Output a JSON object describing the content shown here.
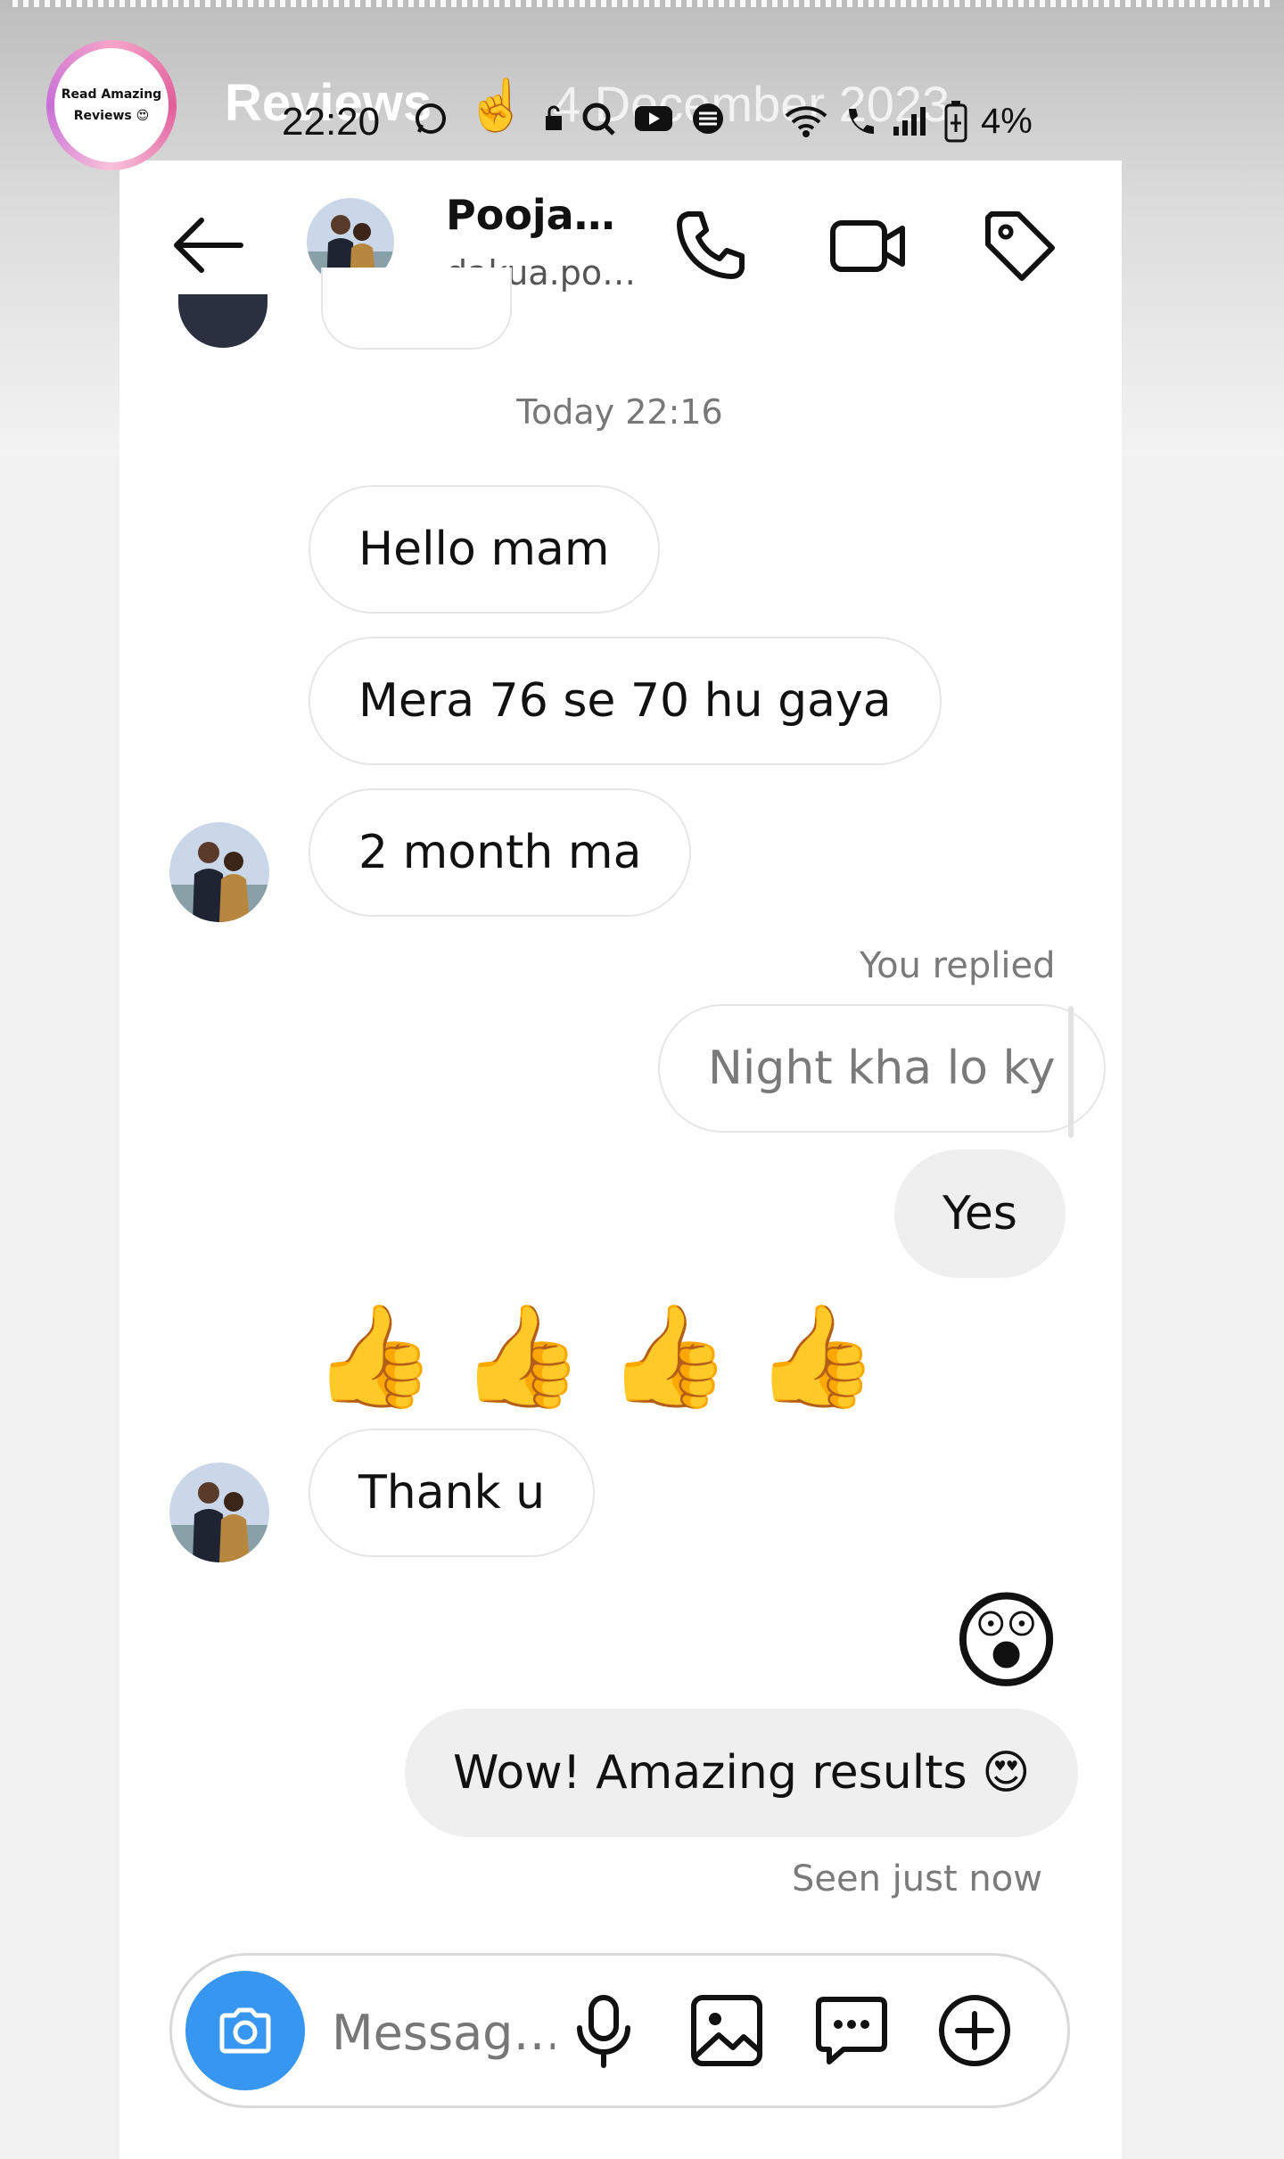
{
  "story": {
    "badge_line1": "Read Amazing",
    "badge_line2": "Reviews 😍",
    "title": "Reviews",
    "pointer_emoji": "☝️",
    "date": "4 December 2023"
  },
  "status_bar": {
    "time": "22:20",
    "battery": "4%"
  },
  "header": {
    "contact_name": "Pooja…",
    "contact_handle": "dakua.po…",
    "icons": [
      "back-arrow-icon",
      "phone-icon",
      "video-camera-icon",
      "tag-icon"
    ]
  },
  "chat": {
    "timestamp": "Today 22:16",
    "incoming": [
      "Hello mam",
      "Mera 76 se 70 hu gaya",
      "2 month ma"
    ],
    "you_replied_label": "You replied",
    "replied_to": "Night kha lo ky",
    "my_reply": "Yes",
    "thumbs": [
      "👍",
      "👍",
      "👍",
      "👍"
    ],
    "thanks": "Thank u",
    "reaction_emoji": "😲",
    "final_message": "Wow! Amazing results 😍",
    "seen": "Seen just now"
  },
  "composer": {
    "placeholder": "Messag…",
    "accent": "#3797f0",
    "icons": [
      "camera-icon",
      "microphone-icon",
      "gallery-icon",
      "chat-bubble-icon",
      "plus-circle-icon"
    ]
  }
}
